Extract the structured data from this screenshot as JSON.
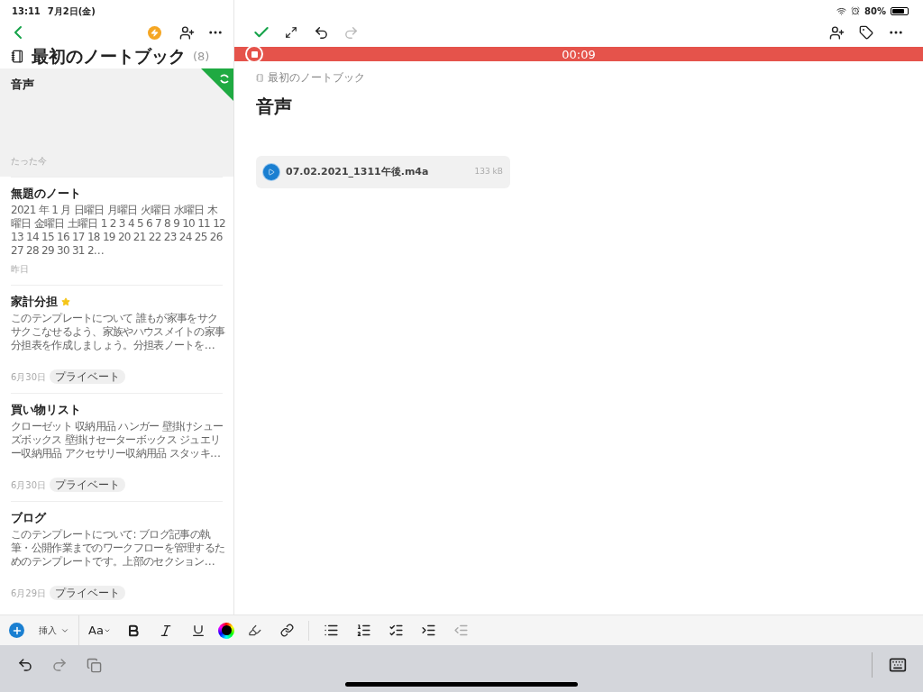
{
  "status_bar": {
    "time": "13:11",
    "date": "7月2日(金)",
    "battery": "80%"
  },
  "notebook": {
    "title": "最初のノートブック",
    "count": "(8)"
  },
  "notes": [
    {
      "title": "音声",
      "date": "たった今",
      "starred": false,
      "selected": true
    },
    {
      "title": "無題のノート",
      "snippet": "2021 年 1 月 日曜日 月曜日 火曜日 水曜日 木曜日 金曜日 土曜日 1 2 3 4 5 6 7 8 9 10 11 12 13 14 15 16 17 18 19 20 21 22 23 24 25 26 27 28 29 30 31 2…",
      "date": "昨日",
      "starred": false,
      "selected": false
    },
    {
      "title": "家計分担",
      "snippet": "このテンプレートについて 誰もが家事をサクサクこなせるよう、家族やハウスメイトの家事分担表を作成しましょう。分担表ノートを…",
      "date": "6月30日",
      "tag": "プライベート",
      "starred": true,
      "selected": false
    },
    {
      "title": "買い物リスト",
      "snippet": "クローゼット 収納用品 ハンガー 壁掛けシューズボックス 壁掛けセーターボックス ジュエリー収納用品 アクセサリー収納用品 スタッキ…",
      "date": "6月30日",
      "tag": "プライベート",
      "starred": false,
      "selected": false
    },
    {
      "title": "ブログ",
      "snippet": "このテンプレートについて: ブログ記事の執筆・公開作業までのワークフローを管理するためのテンプレートです。上部のセクション…",
      "date": "6月29日",
      "tag": "プライベート",
      "starred": false,
      "selected": false
    }
  ],
  "editor": {
    "recording_time": "00:09",
    "breadcrumb": "最初のノートブック",
    "title": "音声",
    "attachment": {
      "name": "07.02.2021_1311午後.m4a",
      "size": "133 kB"
    }
  },
  "format_bar": {
    "insert_label": "挿入",
    "font_size_label": "Aa"
  }
}
